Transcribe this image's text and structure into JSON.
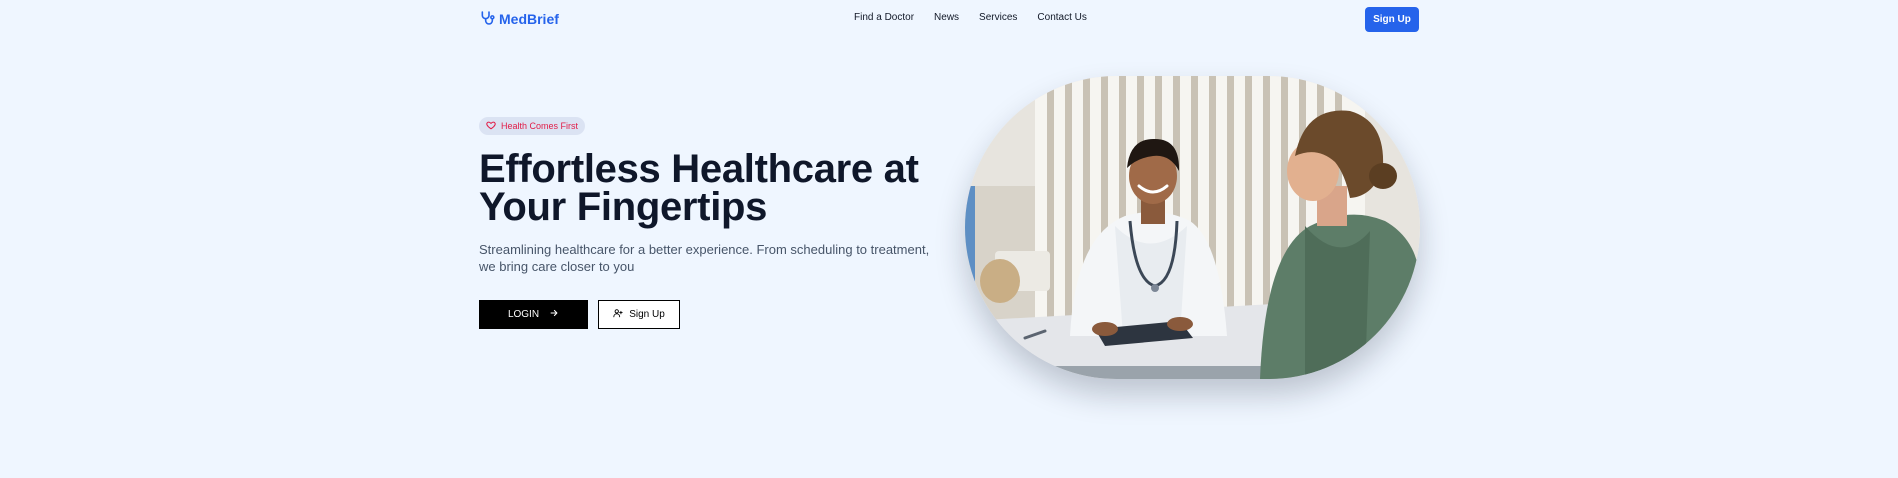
{
  "nav": {
    "brand": "MedBrief",
    "links": [
      "Find a Doctor",
      "News",
      "Services",
      "Contact Us"
    ],
    "signup_label": "Sign Up"
  },
  "hero": {
    "badge": "Health Comes First",
    "title": "Effortless Healthcare at Your Fingertips",
    "subtitle": "Streamlining healthcare for a better experience. From scheduling to treatment, we bring care closer to you",
    "login_label": "LOGIN",
    "signup_label": "Sign Up"
  },
  "colors": {
    "accent": "#2563eb",
    "badge_text": "#e11d48",
    "background": "#eff6ff"
  },
  "icons": [
    "stethoscope-icon",
    "heart-icon",
    "arrow-right-icon",
    "user-plus-icon"
  ]
}
